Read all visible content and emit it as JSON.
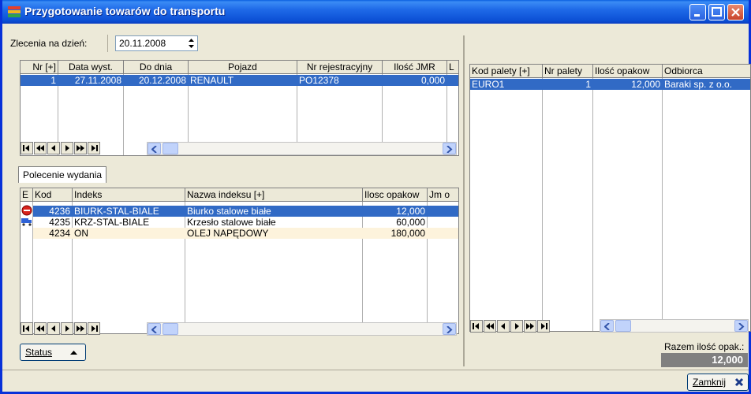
{
  "window": {
    "title": "Przygotowanie towarów do transportu"
  },
  "filter": {
    "label": "Zlecenia na dzień:",
    "date": "20.11.2008"
  },
  "orders": {
    "columns": [
      "Nr [+]",
      "Data wyst.",
      "Do dnia",
      "Pojazd",
      "Nr rejestracyjny",
      "Ilość JMR",
      "L"
    ],
    "rows": [
      {
        "nr": "1",
        "data": "27.11.2008",
        "do": "20.12.2008",
        "pojazd": "RENAULT",
        "rej": "PO12378",
        "ilosc": "0,000"
      }
    ]
  },
  "release": {
    "tab": "Polecenie wydania",
    "columns": [
      "E",
      "Kod",
      "Indeks",
      "Nazwa indeksu [+]",
      "Ilosc opakow",
      "Jm o"
    ],
    "rows": [
      {
        "kod": "4236",
        "indeks": "BIURK-STAL-BIALE",
        "nazwa": "Biurko stalowe białe",
        "ilosc": "12,000"
      },
      {
        "kod": "4235",
        "indeks": "KRZ-STAL-BIALE",
        "nazwa": "Krzesło stalowe białe",
        "ilosc": "60,000"
      },
      {
        "kod": "4234",
        "indeks": "ON",
        "nazwa": "OLEJ NAPĘDOWY",
        "ilosc": "180,000"
      }
    ],
    "status_button": "Status"
  },
  "pallets": {
    "columns": [
      "Kod palety [+]",
      "Nr palety",
      "Ilość opakow",
      "Odbiorca"
    ],
    "rows": [
      {
        "kod": "EURO1",
        "nr": "1",
        "ilosc": "12,000",
        "odbiorca": "Baraki sp. z o.o."
      }
    ],
    "sum_label": "Razem ilość opak.:",
    "sum_value": "12,000"
  },
  "footer": {
    "close_button": "Zamknij"
  }
}
